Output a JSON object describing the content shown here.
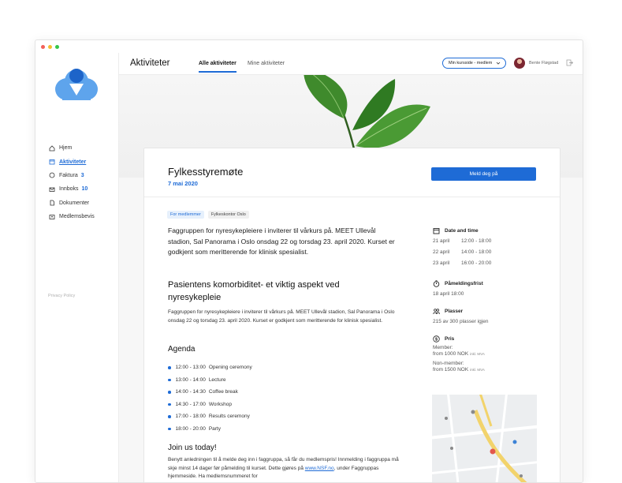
{
  "colors": {
    "accent": "#1e6bd6",
    "dot_red": "#f26059",
    "dot_yellow": "#f5bd2e",
    "dot_green": "#35c649"
  },
  "sidebar": {
    "items": [
      {
        "label": "Hjem",
        "icon": "home-icon"
      },
      {
        "label": "Aktiviteter",
        "icon": "calendar-icon",
        "active": true
      },
      {
        "label": "Faktura",
        "icon": "invoice-icon",
        "count": "3"
      },
      {
        "label": "Innboks",
        "icon": "mail-icon",
        "count": "10"
      },
      {
        "label": "Dokumenter",
        "icon": "document-icon"
      },
      {
        "label": "Medlemsbevis",
        "icon": "id-card-icon"
      }
    ],
    "privacy": "Privacy Policy"
  },
  "header": {
    "title": "Aktiviteter",
    "tabs": [
      {
        "label": "Alle aktiviteter",
        "active": true
      },
      {
        "label": "Mine aktiviteter"
      }
    ],
    "course_select": "Min kursside - medlem",
    "user": "Bente Fløgstad"
  },
  "event": {
    "title": "Fylkesstyremøte",
    "date": "7 mai 2020",
    "signup": "Meld deg på",
    "tags": [
      "For medlemmer",
      "Fylkeskontor Oslo"
    ],
    "intro": "Faggruppen for nyresykepleiere i inviterer til vårkurs på.  MEET Ullevål stadion, Sal Panorama i Oslo onsdag 22  og torsdag 23. april 2020.  Kurset er godkjent som meritterende for klinisk spesialist.",
    "subtitle": "Pasientens komorbiditet- et viktig aspekt ved nyresykepleie",
    "paragraph": "Faggruppen for nyresykepleiere i inviterer til vårkurs på. MEET Ullevål stadion, Sal Panorama i Oslo onsdag 22  og torsdag 23. april 2020.  Kurset er godkjent som meritterende for klinisk spesialist.",
    "agenda_title": "Agenda",
    "agenda": [
      {
        "time": "12:00 - 13:00",
        "item": "Opening ceremony"
      },
      {
        "time": "13:00 - 14:00",
        "item": "Lecture"
      },
      {
        "time": "14:00 - 14:30",
        "item": "Coffee break"
      },
      {
        "time": "14:30 - 17:00",
        "item": "Workshop"
      },
      {
        "time": "17:00 - 18:00",
        "item": "Results ceremony"
      },
      {
        "time": "18:00 - 20:00",
        "item": "Party"
      }
    ],
    "join_title": "Join us today!",
    "join_text_1": "Benytt anledningen til å melde deg inn i faggruppa, så får du medlemspris! Innmelding i faggruppa må skje minst 14 dager før påmelding til kurset. Dette gjøres på ",
    "join_link": "www.NSF.no",
    "join_text_2": ", under Faggruppas hjemmeside. Ha medlemsnummeret for"
  },
  "details": {
    "date_title": "Date and time",
    "dates": [
      {
        "day": "21 april",
        "time": "12:00 - 18:00"
      },
      {
        "day": "22 april",
        "time": "14:00 - 18:00"
      },
      {
        "day": "23 april",
        "time": "16:00 - 20:00"
      }
    ],
    "deadline_title": "Påmeldingsfrist",
    "deadline": "18 april 18:00",
    "seats_title": "Plasser",
    "seats": "215 av 300 plasser igjen",
    "price_title": "Pris",
    "member_label": "Member:",
    "member_price": "from 1000 NOK",
    "nonmember_label": "Non-member:",
    "nonmember_price": "from 1500 NOK",
    "vat": "inkl. MVA"
  }
}
